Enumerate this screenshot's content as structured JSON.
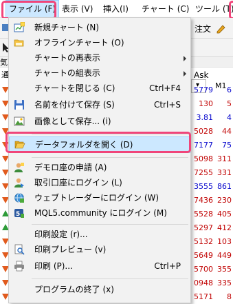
{
  "menubar": {
    "items": [
      "ファイル (F)",
      "表示 (V)",
      "挿入(I)",
      "チャート (C)",
      "ツール (T)"
    ]
  },
  "toolbar": {
    "partial_text": "注文",
    "timeframe": "M1",
    "panel_title_fragment": "気西",
    "col_fragment": "通",
    "ask_header": "Ask"
  },
  "bid_rows": [
    {
      "dir": "down",
      "a": "5779",
      "b": "6",
      "blue": true
    },
    {
      "dir": "down",
      "a": "130",
      "b": "5",
      "blue": false
    },
    {
      "dir": "down",
      "a": "3.81",
      "b": "4",
      "blue": true
    },
    {
      "dir": "down",
      "a": "5028",
      "b": "44",
      "blue": false
    },
    {
      "dir": "down",
      "a": "7177",
      "b": "75",
      "blue": true
    },
    {
      "dir": "down",
      "a": "5098",
      "b": "311",
      "blue": false
    },
    {
      "dir": "down",
      "a": "7255",
      "b": "331",
      "blue": false
    },
    {
      "dir": "down",
      "a": "3555",
      "b": "861",
      "blue": true
    },
    {
      "dir": "down",
      "a": "7436",
      "b": "230",
      "blue": false
    },
    {
      "dir": "up",
      "a": "5528",
      "b": "405",
      "blue": false
    },
    {
      "dir": "up",
      "a": "5297",
      "b": "412",
      "blue": false
    },
    {
      "dir": "down",
      "a": "5132",
      "b": "103",
      "blue": false
    },
    {
      "dir": "down",
      "a": "5649",
      "b": "449",
      "blue": false
    },
    {
      "dir": "down",
      "a": "5700",
      "b": "355",
      "blue": false
    },
    {
      "dir": "down",
      "a": "0948",
      "b": "335",
      "blue": false
    },
    {
      "dir": "down",
      "a": "5171",
      "b": "8",
      "blue": false
    }
  ],
  "menu": {
    "items": [
      {
        "label": "新規チャート (N)",
        "shortcut": "",
        "submenu": false,
        "icon": "new-chart-icon"
      },
      {
        "label": "オフラインチャート (O)",
        "shortcut": "",
        "submenu": false,
        "icon": "offline-folder-icon"
      },
      {
        "label": "チャートの再表示",
        "shortcut": "",
        "submenu": true,
        "icon": ""
      },
      {
        "label": "チャートの組表示",
        "shortcut": "",
        "submenu": true,
        "icon": ""
      },
      {
        "label": "チャートを閉じる (C)",
        "shortcut": "Ctrl+F4",
        "submenu": false,
        "icon": ""
      },
      {
        "label": "名前を付けて保存 (S)",
        "shortcut": "Ctrl+S",
        "submenu": false,
        "icon": "save-icon"
      },
      {
        "label": "画像として保存... (i)",
        "shortcut": "",
        "submenu": false,
        "icon": "save-image-icon"
      },
      {
        "label": "データフォルダを開く (D)",
        "shortcut": "",
        "submenu": false,
        "icon": "open-folder-icon"
      },
      {
        "label": "デモロ座の申請 (A)",
        "shortcut": "",
        "submenu": false,
        "icon": "demo-account-icon"
      },
      {
        "label": "取引口座にログイン (L)",
        "shortcut": "",
        "submenu": false,
        "icon": "login-account-icon"
      },
      {
        "label": "ウェブトレーダーにログイン (W)",
        "shortcut": "",
        "submenu": false,
        "icon": "webtrader-icon"
      },
      {
        "label": "MQL5.community にログイン (M)",
        "shortcut": "",
        "submenu": false,
        "icon": "mql5-icon"
      },
      {
        "label": "印刷設定 (r)...",
        "shortcut": "",
        "submenu": false,
        "icon": ""
      },
      {
        "label": "印刷プレビュー (v)",
        "shortcut": "",
        "submenu": false,
        "icon": "print-preview-icon"
      },
      {
        "label": "印刷 (P)...",
        "shortcut": "Ctrl+P",
        "submenu": false,
        "icon": "printer-icon"
      },
      {
        "label": "プログラムの終了 (x)",
        "shortcut": "",
        "submenu": false,
        "icon": ""
      }
    ]
  },
  "colors": {
    "highlight_frame": "#f0457a",
    "hover_bg": "#cce8ff",
    "down_arrow": "#e15b1e",
    "up_arrow": "#2e9c3a"
  }
}
